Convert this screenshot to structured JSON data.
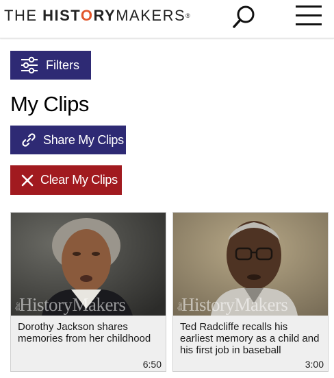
{
  "header": {
    "logo_the": "THE ",
    "logo_hist": "HIST",
    "logo_o": "O",
    "logo_ry": "RY",
    "logo_makers": "MAKERS",
    "logo_reg": "®"
  },
  "toolbar": {
    "filters_label": "Filters",
    "share_label": "Share My Clips",
    "clear_label": "Clear My Clips"
  },
  "page": {
    "title": "My Clips"
  },
  "clips": [
    {
      "caption": "Dorothy Jackson shares memories from her childhood",
      "duration": "6:50",
      "watermark_the": "the",
      "watermark_text": "HistoryMakers"
    },
    {
      "caption": "Ted Radcliffe recalls his earliest memory as a child and his first job in baseball",
      "duration": "3:00",
      "watermark_the": "the",
      "watermark_text": "HistoryMakers"
    }
  ],
  "colors": {
    "brand_navy": "#2e2a74",
    "danger_red": "#a11a1f",
    "logo_accent": "#e2562b"
  },
  "icons": [
    "search-icon",
    "hamburger-menu-icon",
    "sliders-icon",
    "link-icon",
    "close-icon"
  ]
}
